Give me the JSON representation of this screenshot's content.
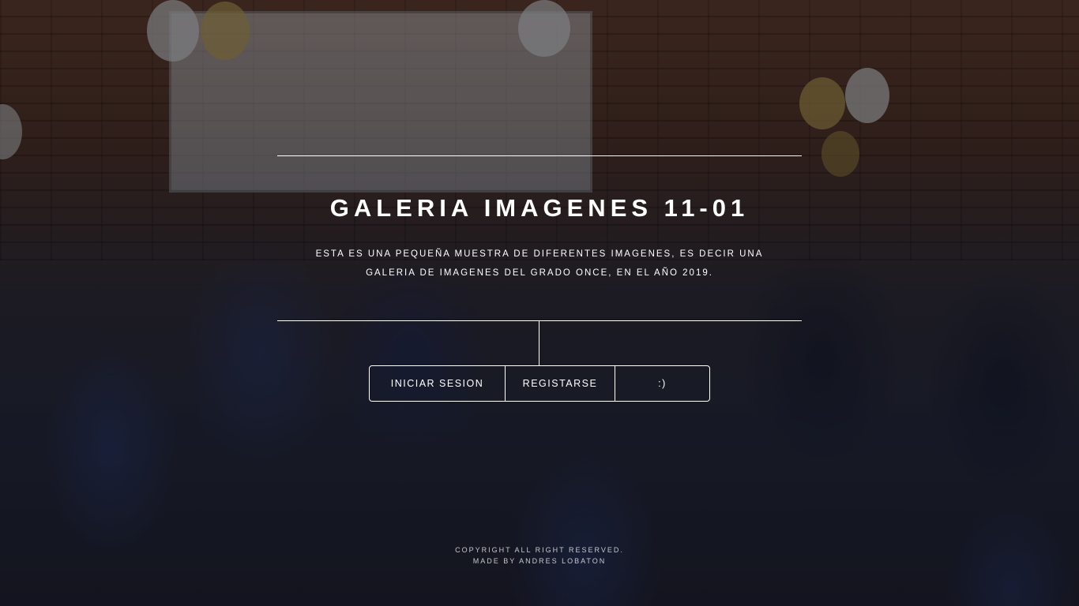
{
  "header": {
    "title": "GALERIA IMAGENES 11-01",
    "description": "ESTA ES UNA PEQUEÑA MUESTRA DE DIFERENTES IMAGENES, ES DECIR UNA GALERIA DE IMAGENES DEL GRADO ONCE, EN EL AÑO 2019."
  },
  "nav": {
    "items": [
      {
        "label": "INICIAR SESION"
      },
      {
        "label": "REGISTARSE"
      },
      {
        "label": ":)"
      }
    ]
  },
  "footer": {
    "copyright": "COPYRIGHT ALL RIGHT RESERVED.",
    "credit": "MADE BY ANDRES LOBATON"
  },
  "background": {
    "image": "class-group-photo",
    "overlay_color": "#000000"
  }
}
